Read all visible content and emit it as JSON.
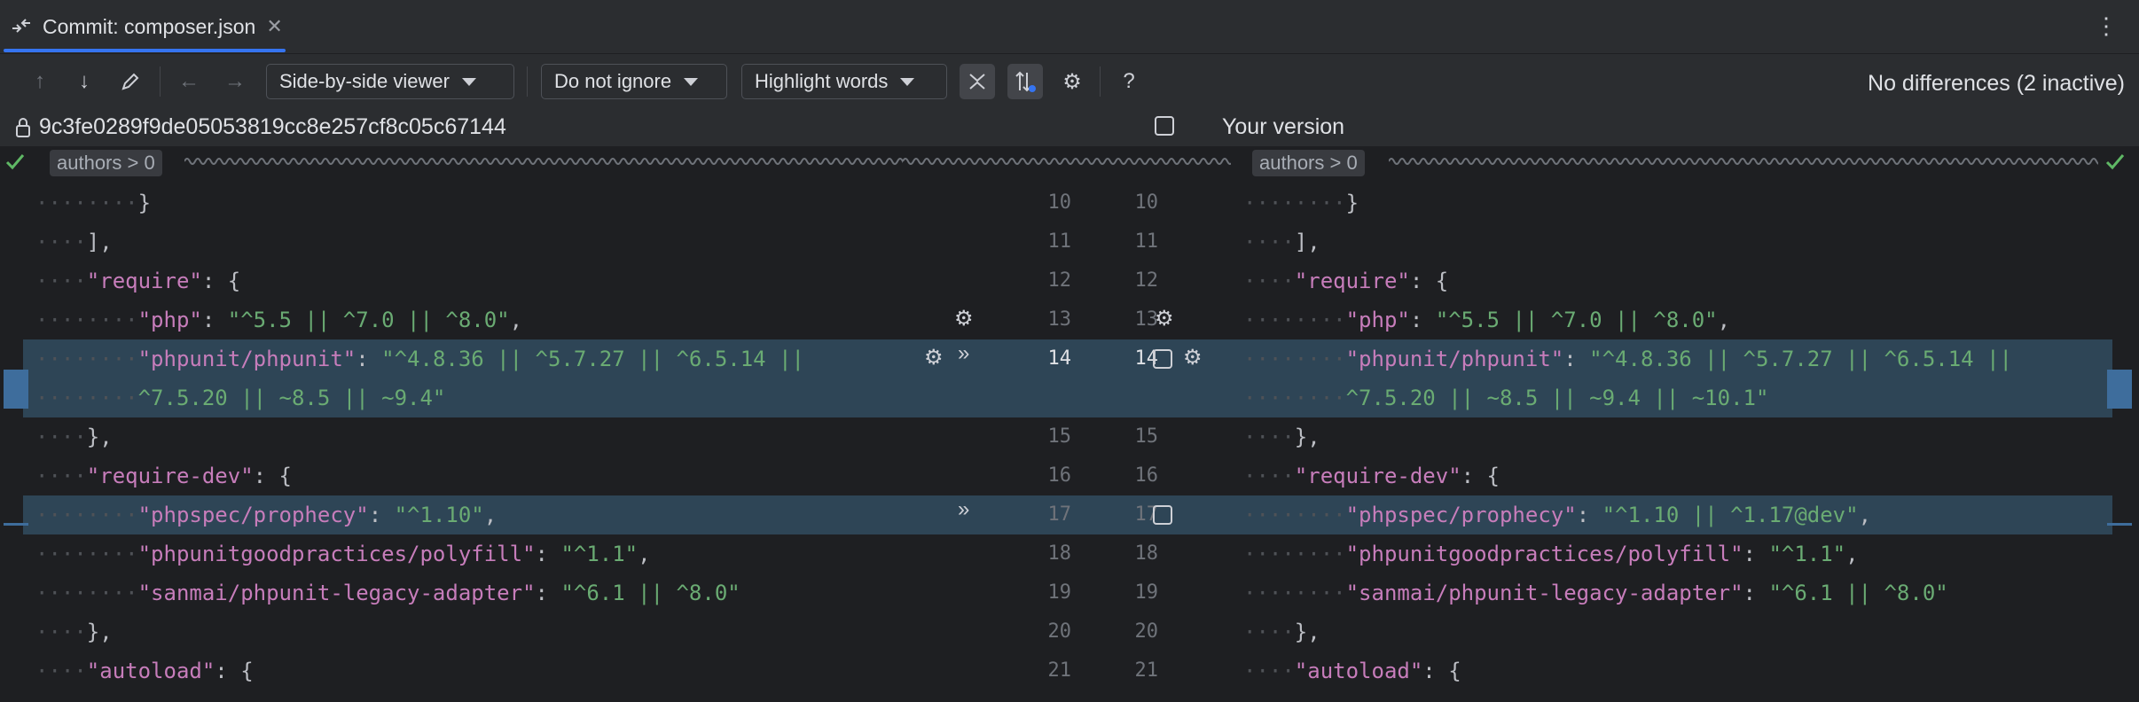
{
  "tab": {
    "title": "Commit: composer.json",
    "close": "✕",
    "more": "⋮"
  },
  "toolbar": {
    "viewer": "Side-by-side viewer",
    "ignore": "Do not ignore",
    "highlight": "Highlight words",
    "help": "?",
    "status": "No differences (2 inactive)"
  },
  "header": {
    "left_revision": "9c3fe0289f9de05053819cc8e257cf8c05c67144",
    "right_label": "Your version"
  },
  "breadcrumb": {
    "left": "authors > 0",
    "right": "authors > 0"
  },
  "left_numbers": [
    "10",
    "11",
    "12",
    "13",
    "14",
    "",
    "15",
    "16",
    "17",
    "18",
    "19",
    "20",
    "21"
  ],
  "right_numbers": [
    "10",
    "11",
    "12",
    "13",
    "14",
    "",
    "15",
    "16",
    "17",
    "18",
    "19",
    "20",
    "21"
  ],
  "left_lines": [
    "········}",
    "····],",
    "····\"require\": {",
    "········\"php\": \"^5.5 || ^7.0 || ^8.0\",",
    "········\"phpunit/phpunit\": \"^4.8.36 || ^5.7.27 || ^6.5.14 || ",
    "········^7.5.20 || ~8.5 || ~9.4\"",
    "····},",
    "····\"require-dev\": {",
    "········\"phpspec/prophecy\": \"^1.10\",",
    "········\"phpunitgoodpractices/polyfill\": \"^1.1\",",
    "········\"sanmai/phpunit-legacy-adapter\": \"^6.1 || ^8.0\"",
    "····},",
    "····\"autoload\": {"
  ],
  "right_lines": [
    "········}",
    "····],",
    "····\"require\": {",
    "········\"php\": \"^5.5 || ^7.0 || ^8.0\",",
    "········\"phpunit/phpunit\": \"^4.8.36 || ^5.7.27 || ^6.5.14 || ",
    "········^7.5.20 || ~8.5 || ~9.4 || ~10.1\"",
    "····},",
    "····\"require-dev\": {",
    "········\"phpspec/prophecy\": \"^1.10 || ^1.17@dev\",",
    "········\"phpunitgoodpractices/polyfill\": \"^1.1\",",
    "········\"sanmai/phpunit-legacy-adapter\": \"^6.1 || ^8.0\"",
    "····},",
    "····\"autoload\": {"
  ],
  "colors": {
    "accent": "#3574f0",
    "key": "#c77dbb",
    "string": "#6aab73",
    "changed_bg": "#2e4556"
  }
}
